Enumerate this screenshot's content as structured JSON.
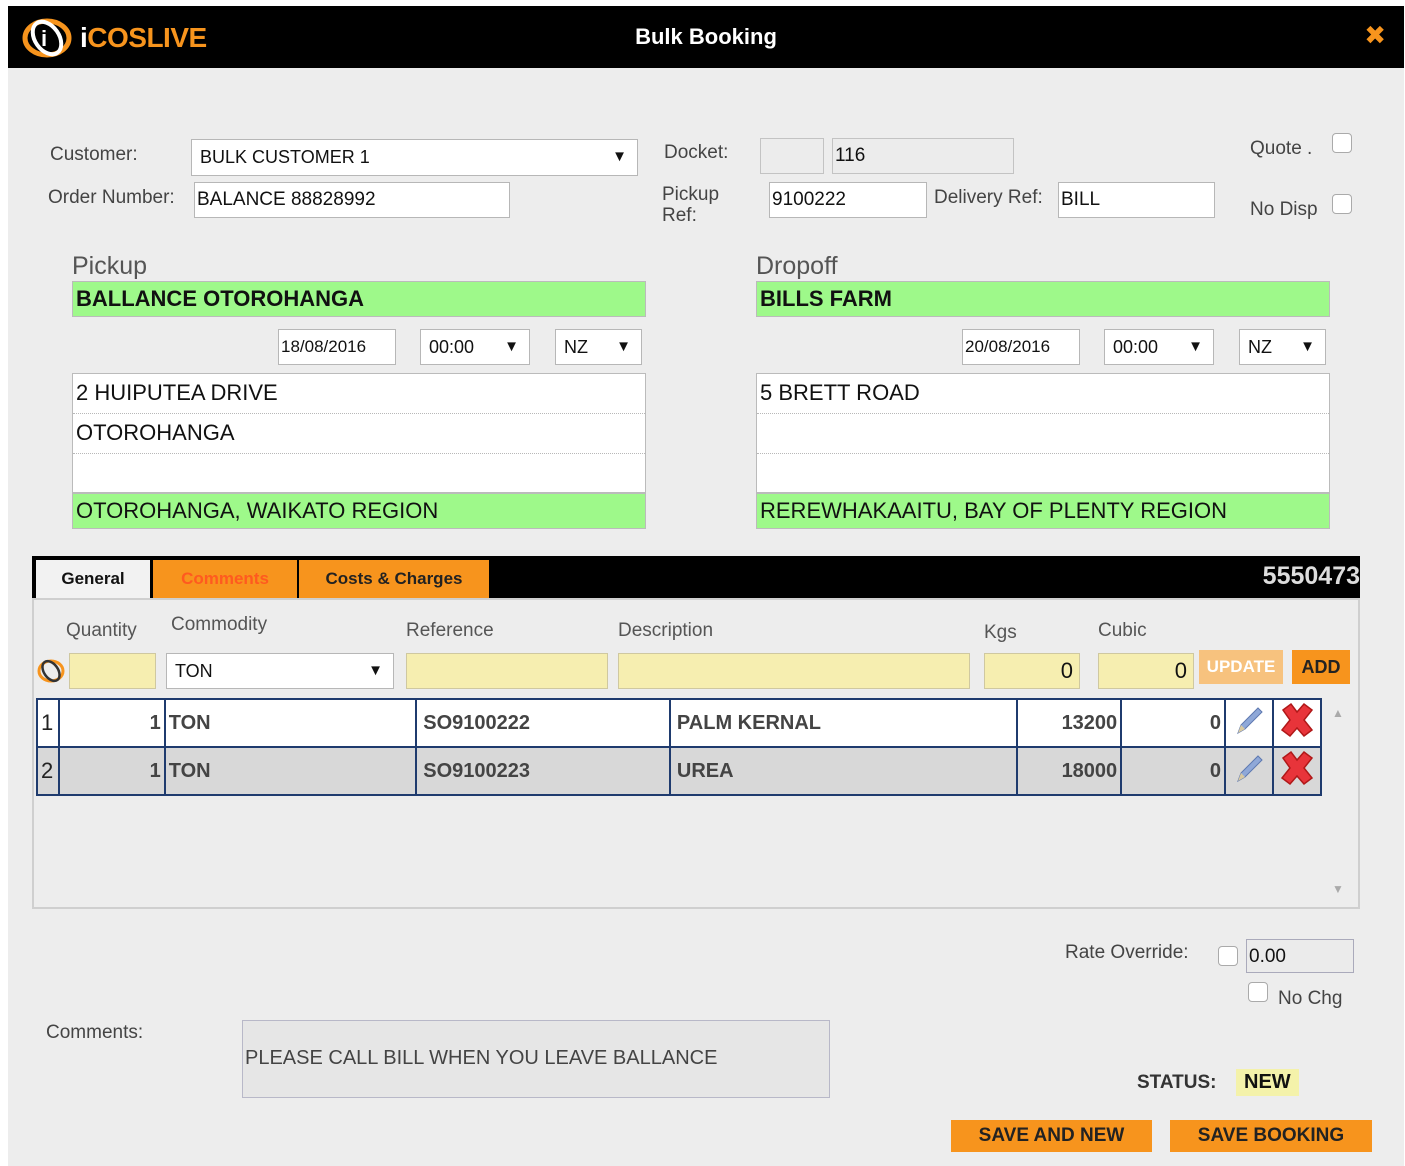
{
  "window": {
    "title": "Bulk Booking",
    "brand": "iCOSLIVE",
    "brand_prefix": "i",
    "brand_rest": "COSLIVE",
    "close_icon": "close-icon"
  },
  "header": {
    "customer_label": "Customer:",
    "customer_value": "BULK CUSTOMER 1",
    "order_number_label": "Order Number:",
    "order_number_value": "BALANCE 88828992",
    "docket_label": "Docket:",
    "docket_prefix": "",
    "docket_value": "116",
    "pickup_ref_label": "Pickup Ref:",
    "pickup_ref_value": "9100222",
    "delivery_ref_label": "Delivery Ref:",
    "delivery_ref_value": "BILL",
    "quote_label": "Quote .",
    "no_disp_label": "No Disp"
  },
  "pickup": {
    "title": "Pickup",
    "name": "BALLANCE OTOROHANGA",
    "date": "18/08/2016",
    "time": "00:00",
    "tz": "NZ",
    "address_lines": [
      "2 HUIPUTEA DRIVE",
      "OTOROHANGA",
      ""
    ],
    "region": "OTOROHANGA, WAIKATO REGION"
  },
  "dropoff": {
    "title": "Dropoff",
    "name": "BILLS FARM",
    "date": "20/08/2016",
    "time": "00:00",
    "tz": "NZ",
    "address_lines": [
      "5 BRETT ROAD",
      "",
      ""
    ],
    "region": "REREWHAKAAITU, BAY OF PLENTY REGION"
  },
  "tabs": {
    "general": "General",
    "comments": "Comments",
    "costs": "Costs & Charges",
    "docket_number": "5550473"
  },
  "line_entry": {
    "headers": {
      "quantity": "Quantity",
      "commodity": "Commodity",
      "reference": "Reference",
      "description": "Description",
      "kgs": "Kgs",
      "cubic": "Cubic"
    },
    "commodity_value": "TON",
    "kgs_value": "0",
    "cubic_value": "0",
    "update_label": "UPDATE",
    "add_label": "ADD"
  },
  "lines": [
    {
      "idx": "1",
      "qty": "1",
      "commodity": "TON",
      "reference": "SO9100222",
      "description": "PALM KERNAL",
      "kgs": "13200",
      "cubic": "0"
    },
    {
      "idx": "2",
      "qty": "1",
      "commodity": "TON",
      "reference": "SO9100223",
      "description": "UREA",
      "kgs": "18000",
      "cubic": "0"
    }
  ],
  "footer": {
    "rate_override_label": "Rate Override:",
    "rate_value": "0.00",
    "no_chg_label": "No Chg",
    "comments_label": "Comments:",
    "comments_value": "PLEASE CALL BILL WHEN YOU LEAVE BALLANCE",
    "status_label": "STATUS:",
    "status_value": "NEW",
    "save_and_new_label": "SAVE AND NEW",
    "save_booking_label": "SAVE BOOKING"
  },
  "colors": {
    "accent": "#f7941d",
    "green": "#9ef98a",
    "yellow_input": "#f6eeb0",
    "table_border": "#1f3b6e"
  }
}
